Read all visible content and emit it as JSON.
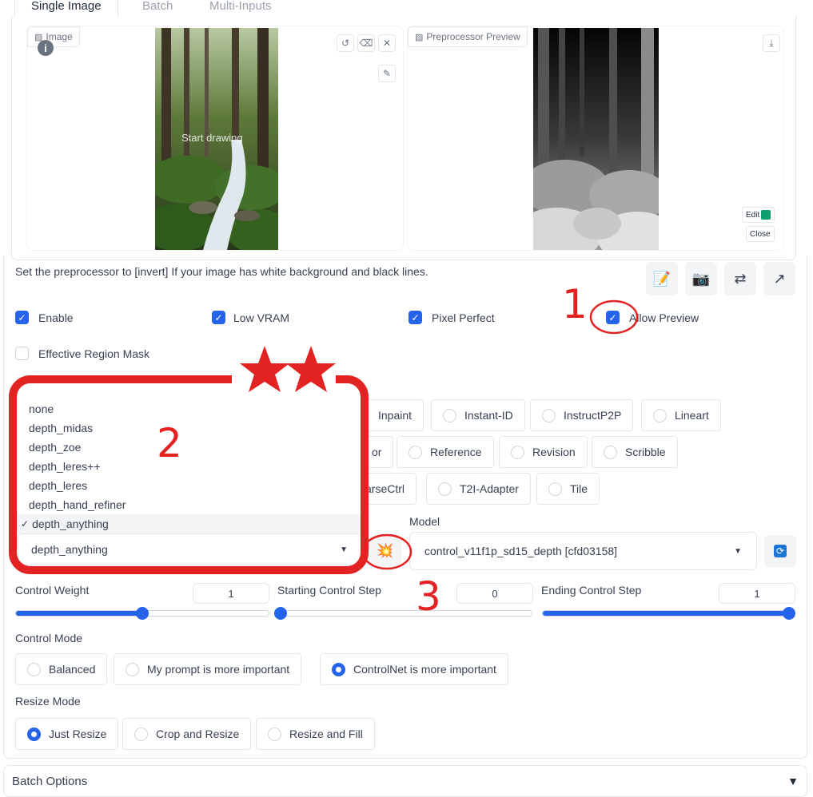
{
  "tabs": [
    {
      "label": "Single Image"
    },
    {
      "label": "Batch"
    },
    {
      "label": "Multi-Inputs"
    }
  ],
  "image_panel": {
    "label": "Image",
    "overlay_text": "Start drawing",
    "buttons": [
      "undo-icon",
      "eraser-icon",
      "close-icon",
      "brush-icon"
    ]
  },
  "preview_panel": {
    "label": "Preprocessor Preview",
    "edit_label": "Edit",
    "close_label": "Close"
  },
  "hint_text": "Set the preprocessor to [invert] If your image has white background and black lines.",
  "toolbar_icons": [
    "notepad-icon",
    "camera-icon",
    "swap-icon",
    "send-arrow-icon"
  ],
  "checkboxes": {
    "enable": "Enable",
    "low_vram": "Low VRAM",
    "pixel_perfect": "Pixel Perfect",
    "allow_preview": "Allow Preview",
    "effective_region_mask": "Effective Region Mask"
  },
  "control_types": {
    "row1": [
      "Inpaint",
      "Instant-ID",
      "InstructP2P",
      "Lineart"
    ],
    "row2_partial": "or",
    "row2": [
      "Reference",
      "Revision",
      "Scribble"
    ],
    "row3_partial": "arseCtrl",
    "row3": [
      "T2I-Adapter",
      "Tile"
    ]
  },
  "preprocessor_dropdown": {
    "options": [
      "none",
      "depth_midas",
      "depth_zoe",
      "depth_leres++",
      "depth_leres",
      "depth_hand_refiner",
      "depth_anything"
    ],
    "checked_mark": "✓",
    "selected": "depth_anything"
  },
  "model": {
    "label": "Model",
    "value": "control_v11f1p_sd15_depth [cfd03158]"
  },
  "sliders": {
    "control_weight": {
      "label": "Control Weight",
      "value": "1",
      "fraction": 0.5
    },
    "starting_step": {
      "label": "Starting Control Step",
      "value": "0",
      "fraction": 0.0
    },
    "ending_step": {
      "label": "Ending Control Step",
      "value": "1",
      "fraction": 1.0
    }
  },
  "control_mode": {
    "label": "Control Mode",
    "options": [
      "Balanced",
      "My prompt is more important",
      "ControlNet is more important"
    ],
    "selected": "ControlNet is more important"
  },
  "resize_mode": {
    "label": "Resize Mode",
    "options": [
      "Just Resize",
      "Crop and Resize",
      "Resize and Fill"
    ],
    "selected": "Just Resize"
  },
  "batch_options": {
    "label": "Batch Options"
  },
  "annotations": {
    "n1": "1",
    "n2": "2",
    "n3": "3"
  },
  "colors": {
    "accent": "#2563eb",
    "annotation": "#e32222"
  }
}
